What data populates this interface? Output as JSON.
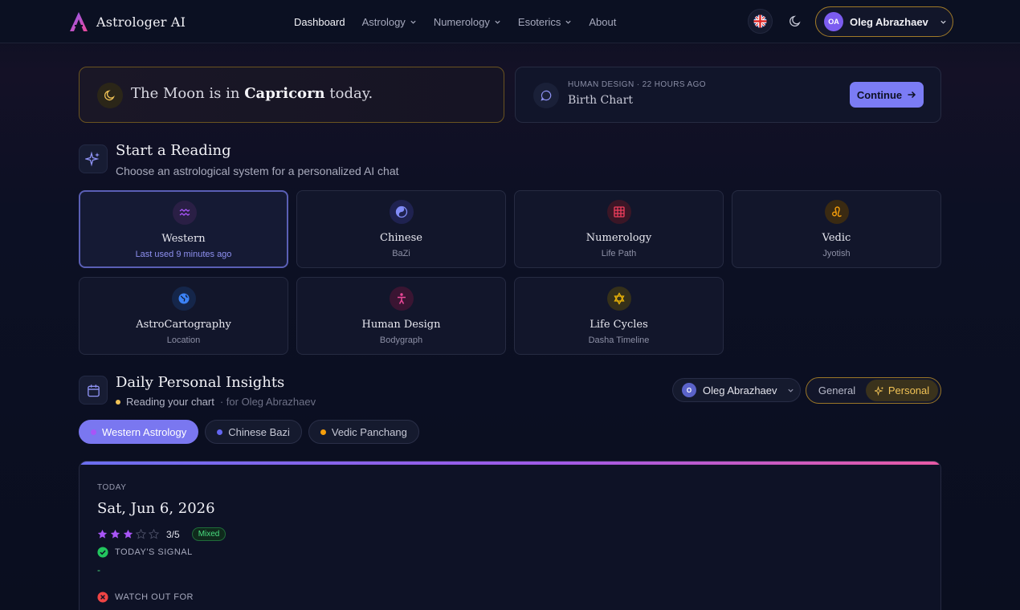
{
  "app": {
    "name": "Astrologer AI"
  },
  "nav": {
    "items": [
      {
        "label": "Dashboard",
        "dropdown": false
      },
      {
        "label": "Astrology",
        "dropdown": true
      },
      {
        "label": "Numerology",
        "dropdown": true
      },
      {
        "label": "Esoterics",
        "dropdown": true
      },
      {
        "label": "About",
        "dropdown": false
      }
    ]
  },
  "user": {
    "initials": "OA",
    "name": "Oleg Abrazhaev"
  },
  "moon": {
    "prefix": "The Moon is in",
    "sign": "Capricorn",
    "suffix": "today."
  },
  "recent": {
    "meta": "HUMAN DESIGN · 22 HOURS AGO",
    "title": "Birth Chart",
    "button": "Continue"
  },
  "reading": {
    "title": "Start a Reading",
    "subtitle": "Choose an astrological system for a personalized AI chat",
    "systems": [
      {
        "title": "Western",
        "sub": "Last used 9 minutes ago",
        "icon": "aquarius-icon",
        "color": "#a855f7"
      },
      {
        "title": "Chinese",
        "sub": "BaZi",
        "icon": "yin-yang-icon",
        "color": "#6366f1"
      },
      {
        "title": "Numerology",
        "sub": "Life Path",
        "icon": "grid-icon",
        "color": "#f43f5e"
      },
      {
        "title": "Vedic",
        "sub": "Jyotish",
        "icon": "leo-icon",
        "color": "#f59e0b"
      },
      {
        "title": "AstroCartography",
        "sub": "Location",
        "icon": "globe-icon",
        "color": "#3b82f6"
      },
      {
        "title": "Human Design",
        "sub": "Bodygraph",
        "icon": "person-icon",
        "color": "#ec4899"
      },
      {
        "title": "Life Cycles",
        "sub": "Dasha Timeline",
        "icon": "star-of-david-icon",
        "color": "#eab308"
      }
    ]
  },
  "insights": {
    "title": "Daily Personal Insights",
    "status": "Reading your chart",
    "for_text": "· for Oleg Abrazhaev",
    "person": {
      "initial": "O",
      "name": "Oleg Abrazhaev"
    },
    "toggle": {
      "general": "General",
      "personal": "Personal",
      "selected": "Personal"
    },
    "tabs": [
      {
        "label": "Western Astrology",
        "dot": "#a855f7"
      },
      {
        "label": "Chinese Bazi",
        "dot": "#6366f1"
      },
      {
        "label": "Vedic Panchang",
        "dot": "#f59e0b"
      }
    ],
    "today": {
      "label": "TODAY",
      "date": "Sat, Jun 6, 2026",
      "rating": 3,
      "rating_max": 5,
      "rating_text": "3/5",
      "badge": "Mixed",
      "signal_label": "TODAY'S SIGNAL",
      "signal_value": "-",
      "watch_label": "WATCH OUT FOR"
    }
  }
}
